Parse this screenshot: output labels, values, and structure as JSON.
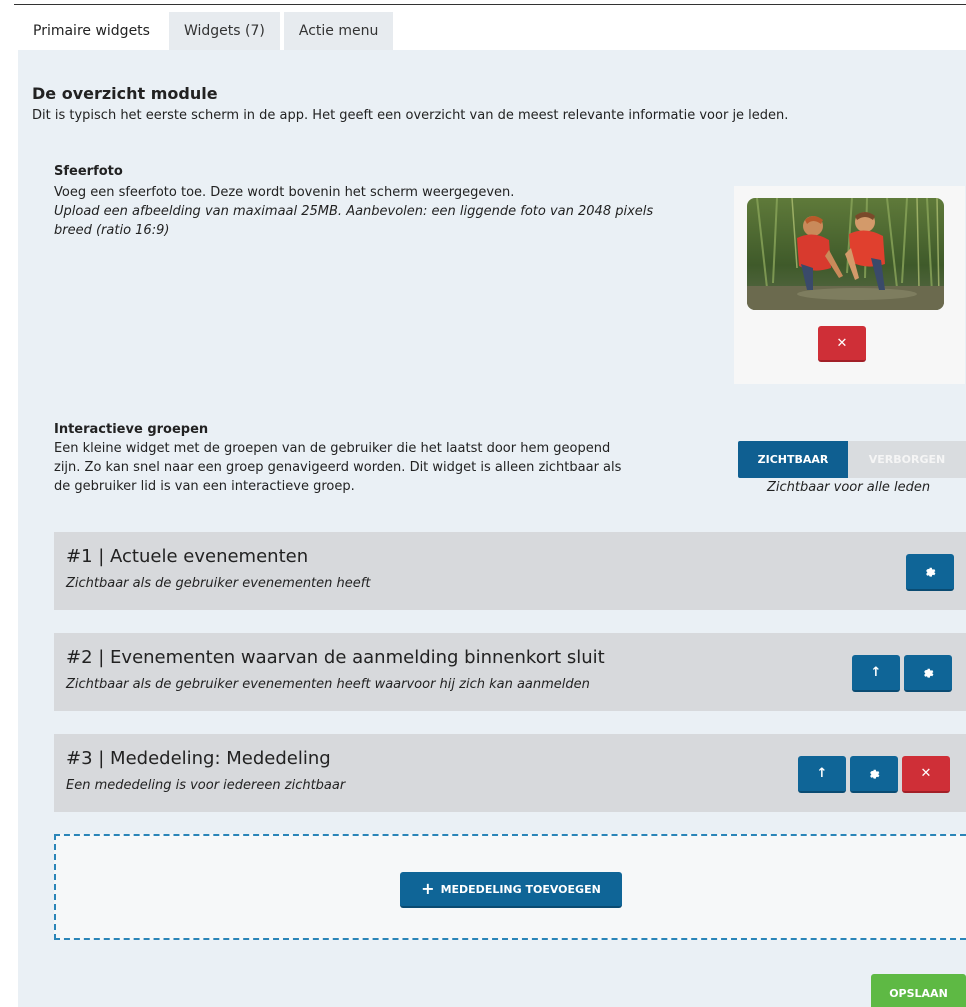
{
  "tabs": [
    {
      "label": "Primaire widgets",
      "active": true
    },
    {
      "label": "Widgets (7)",
      "active": false
    },
    {
      "label": "Actie menu",
      "active": false
    }
  ],
  "module": {
    "title": "De overzicht module",
    "description": "Dit is typisch het eerste scherm in de app. Het geeft een overzicht van de meest relevante informatie voor je leden."
  },
  "sfeerfoto": {
    "title": "Sfeerfoto",
    "description": "Voeg een sfeerfoto toe. Deze wordt bovenin het scherm weergegeven.",
    "hint": "Upload een afbeelding van maximaal 25MB. Aanbevolen: een liggende foto van 2048 pixels breed (ratio 16:9)",
    "delete_icon": "close-icon"
  },
  "interactieve_groepen": {
    "title": "Interactieve groepen",
    "description": "Een kleine widget met de groepen van de gebruiker die het laatst door hem geopend zijn. Zo kan snel naar een groep genavigeerd worden. Dit widget is alleen zichtbaar als de gebruiker lid is van een interactieve groep.",
    "toggle_on": "ZICHTBAAR",
    "toggle_off": "VERBORGEN",
    "selected": "ZICHTBAAR",
    "caption": "Zichtbaar voor alle leden"
  },
  "widgets": [
    {
      "title": "#1 | Actuele evenementen",
      "subtitle": "Zichtbaar als de gebruiker evenementen heeft"
    },
    {
      "title": "#2 | Evenementen waarvan de aanmelding binnenkort sluit",
      "subtitle": "Zichtbaar als de gebruiker evenementen heeft waarvoor hij zich kan aanmelden"
    },
    {
      "title": "#3 | Mededeling: Mededeling",
      "subtitle": "Een mededeling is voor iedereen zichtbaar"
    }
  ],
  "add_button": {
    "label": "MEDEDELING TOEVOEGEN",
    "icon": "plus-icon"
  },
  "save_button": {
    "label": "OPSLAAN"
  },
  "colors": {
    "primary": "#0f6597",
    "danger": "#cf2f37",
    "success": "#5eb944",
    "panel": "#eaf0f5"
  }
}
